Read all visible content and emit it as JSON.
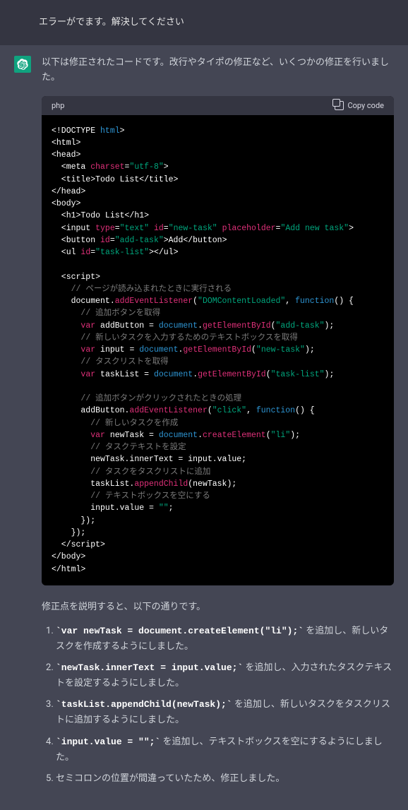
{
  "user_message": "エラーがでます。解決してください",
  "assistant_intro": "以下は修正されたコードです。改行やタイポの修正など、いくつかの修正を行いました。",
  "code_lang": "php",
  "copy_label": "Copy code",
  "explanation_heading": "修正点を説明すると、以下の通りです。",
  "fixes": [
    {
      "code": "`var newTask = document.createElement(\"li\");`",
      "text": " を追加し、新しいタスクを作成するようにしました。"
    },
    {
      "code": "`newTask.innerText = input.value;`",
      "text": " を追加し、入力されたタスクテキストを設定するようにしました。"
    },
    {
      "code": "`taskList.appendChild(newTask);`",
      "text": " を追加し、新しいタスクをタスクリストに追加するようにしました。"
    },
    {
      "code": "`input.value = \"\";`",
      "text": " を追加し、テキストボックスを空にするようにしました。"
    },
    {
      "code": "",
      "text": "セミコロンの位置が間違っていたため、修正しました。"
    }
  ],
  "code_lines": [
    [
      {
        "t": "<!DOCTYPE ",
        "c": "c-punct"
      },
      {
        "t": "html",
        "c": "c-tag"
      },
      {
        "t": ">",
        "c": "c-punct"
      }
    ],
    [
      {
        "t": "<html>",
        "c": "c-punct"
      }
    ],
    [
      {
        "t": "<head>",
        "c": "c-punct"
      }
    ],
    [
      {
        "t": "  <meta ",
        "c": "c-punct"
      },
      {
        "t": "charset",
        "c": "c-attr"
      },
      {
        "t": "=",
        "c": "c-punct"
      },
      {
        "t": "\"utf-8\"",
        "c": "c-string"
      },
      {
        "t": ">",
        "c": "c-punct"
      }
    ],
    [
      {
        "t": "  <title>Todo List</title>",
        "c": "c-punct"
      }
    ],
    [
      {
        "t": "</head>",
        "c": "c-punct"
      }
    ],
    [
      {
        "t": "<body>",
        "c": "c-punct"
      }
    ],
    [
      {
        "t": "  <h1>Todo List</h1>",
        "c": "c-punct"
      }
    ],
    [
      {
        "t": "  <input ",
        "c": "c-punct"
      },
      {
        "t": "type",
        "c": "c-attr"
      },
      {
        "t": "=",
        "c": "c-punct"
      },
      {
        "t": "\"text\"",
        "c": "c-string"
      },
      {
        "t": " ",
        "c": ""
      },
      {
        "t": "id",
        "c": "c-attr"
      },
      {
        "t": "=",
        "c": "c-punct"
      },
      {
        "t": "\"new-task\"",
        "c": "c-string"
      },
      {
        "t": " ",
        "c": ""
      },
      {
        "t": "placeholder",
        "c": "c-attr"
      },
      {
        "t": "=",
        "c": "c-punct"
      },
      {
        "t": "\"Add new task\"",
        "c": "c-string"
      },
      {
        "t": ">",
        "c": "c-punct"
      }
    ],
    [
      {
        "t": "  <button ",
        "c": "c-punct"
      },
      {
        "t": "id",
        "c": "c-attr"
      },
      {
        "t": "=",
        "c": "c-punct"
      },
      {
        "t": "\"add-task\"",
        "c": "c-string"
      },
      {
        "t": ">Add</button>",
        "c": "c-punct"
      }
    ],
    [
      {
        "t": "  <ul ",
        "c": "c-punct"
      },
      {
        "t": "id",
        "c": "c-attr"
      },
      {
        "t": "=",
        "c": "c-punct"
      },
      {
        "t": "\"task-list\"",
        "c": "c-string"
      },
      {
        "t": "></ul>",
        "c": "c-punct"
      }
    ],
    [
      {
        "t": "",
        "c": ""
      }
    ],
    [
      {
        "t": "  <script>",
        "c": "c-punct"
      }
    ],
    [
      {
        "t": "    ",
        "c": ""
      },
      {
        "t": "// ページが読み込まれたときに実行される",
        "c": "c-comment"
      }
    ],
    [
      {
        "t": "    document.",
        "c": "c-punct"
      },
      {
        "t": "addEventListener",
        "c": "c-method"
      },
      {
        "t": "(",
        "c": "c-punct"
      },
      {
        "t": "\"DOMContentLoaded\"",
        "c": "c-string"
      },
      {
        "t": ", ",
        "c": "c-punct"
      },
      {
        "t": "function",
        "c": "c-keyword"
      },
      {
        "t": "() {",
        "c": "c-punct"
      }
    ],
    [
      {
        "t": "      ",
        "c": ""
      },
      {
        "t": "// 追加ボタンを取得",
        "c": "c-comment"
      }
    ],
    [
      {
        "t": "      ",
        "c": ""
      },
      {
        "t": "var",
        "c": "c-var"
      },
      {
        "t": " addButton = ",
        "c": "c-punct"
      },
      {
        "t": "document",
        "c": "c-keyword"
      },
      {
        "t": ".",
        "c": "c-punct"
      },
      {
        "t": "getElementById",
        "c": "c-method"
      },
      {
        "t": "(",
        "c": "c-punct"
      },
      {
        "t": "\"add-task\"",
        "c": "c-string"
      },
      {
        "t": ");",
        "c": "c-punct"
      }
    ],
    [
      {
        "t": "      ",
        "c": ""
      },
      {
        "t": "// 新しいタスクを入力するためのテキストボックスを取得",
        "c": "c-comment"
      }
    ],
    [
      {
        "t": "      ",
        "c": ""
      },
      {
        "t": "var",
        "c": "c-var"
      },
      {
        "t": " input = ",
        "c": "c-punct"
      },
      {
        "t": "document",
        "c": "c-keyword"
      },
      {
        "t": ".",
        "c": "c-punct"
      },
      {
        "t": "getElementById",
        "c": "c-method"
      },
      {
        "t": "(",
        "c": "c-punct"
      },
      {
        "t": "\"new-task\"",
        "c": "c-string"
      },
      {
        "t": ");",
        "c": "c-punct"
      }
    ],
    [
      {
        "t": "      ",
        "c": ""
      },
      {
        "t": "// タスクリストを取得",
        "c": "c-comment"
      }
    ],
    [
      {
        "t": "      ",
        "c": ""
      },
      {
        "t": "var",
        "c": "c-var"
      },
      {
        "t": " taskList = ",
        "c": "c-punct"
      },
      {
        "t": "document",
        "c": "c-keyword"
      },
      {
        "t": ".",
        "c": "c-punct"
      },
      {
        "t": "getElementById",
        "c": "c-method"
      },
      {
        "t": "(",
        "c": "c-punct"
      },
      {
        "t": "\"task-list\"",
        "c": "c-string"
      },
      {
        "t": ");",
        "c": "c-punct"
      }
    ],
    [
      {
        "t": "",
        "c": ""
      }
    ],
    [
      {
        "t": "      ",
        "c": ""
      },
      {
        "t": "// 追加ボタンがクリックされたときの処理",
        "c": "c-comment"
      }
    ],
    [
      {
        "t": "      addButton.",
        "c": "c-punct"
      },
      {
        "t": "addEventListener",
        "c": "c-method"
      },
      {
        "t": "(",
        "c": "c-punct"
      },
      {
        "t": "\"click\"",
        "c": "c-string"
      },
      {
        "t": ", ",
        "c": "c-punct"
      },
      {
        "t": "function",
        "c": "c-keyword"
      },
      {
        "t": "() {",
        "c": "c-punct"
      }
    ],
    [
      {
        "t": "        ",
        "c": ""
      },
      {
        "t": "// 新しいタスクを作成",
        "c": "c-comment"
      }
    ],
    [
      {
        "t": "        ",
        "c": ""
      },
      {
        "t": "var",
        "c": "c-var"
      },
      {
        "t": " newTask = ",
        "c": "c-punct"
      },
      {
        "t": "document",
        "c": "c-keyword"
      },
      {
        "t": ".",
        "c": "c-punct"
      },
      {
        "t": "createElement",
        "c": "c-method"
      },
      {
        "t": "(",
        "c": "c-punct"
      },
      {
        "t": "\"li\"",
        "c": "c-string"
      },
      {
        "t": ");",
        "c": "c-punct"
      }
    ],
    [
      {
        "t": "        ",
        "c": ""
      },
      {
        "t": "// タスクテキストを設定",
        "c": "c-comment"
      }
    ],
    [
      {
        "t": "        newTask.innerText = input.value;",
        "c": "c-punct"
      }
    ],
    [
      {
        "t": "        ",
        "c": ""
      },
      {
        "t": "// タスクをタスクリストに追加",
        "c": "c-comment"
      }
    ],
    [
      {
        "t": "        taskList.",
        "c": "c-punct"
      },
      {
        "t": "appendChild",
        "c": "c-method"
      },
      {
        "t": "(newTask);",
        "c": "c-punct"
      }
    ],
    [
      {
        "t": "        ",
        "c": ""
      },
      {
        "t": "// テキストボックスを空にする",
        "c": "c-comment"
      }
    ],
    [
      {
        "t": "        input.value = ",
        "c": "c-punct"
      },
      {
        "t": "\"\"",
        "c": "c-string"
      },
      {
        "t": ";",
        "c": "c-punct"
      }
    ],
    [
      {
        "t": "      });",
        "c": "c-punct"
      }
    ],
    [
      {
        "t": "    });",
        "c": "c-punct"
      }
    ],
    [
      {
        "t": "  </script>",
        "c": "c-punct"
      }
    ],
    [
      {
        "t": "</body>",
        "c": "c-punct"
      }
    ],
    [
      {
        "t": "</html>",
        "c": "c-punct"
      }
    ]
  ]
}
